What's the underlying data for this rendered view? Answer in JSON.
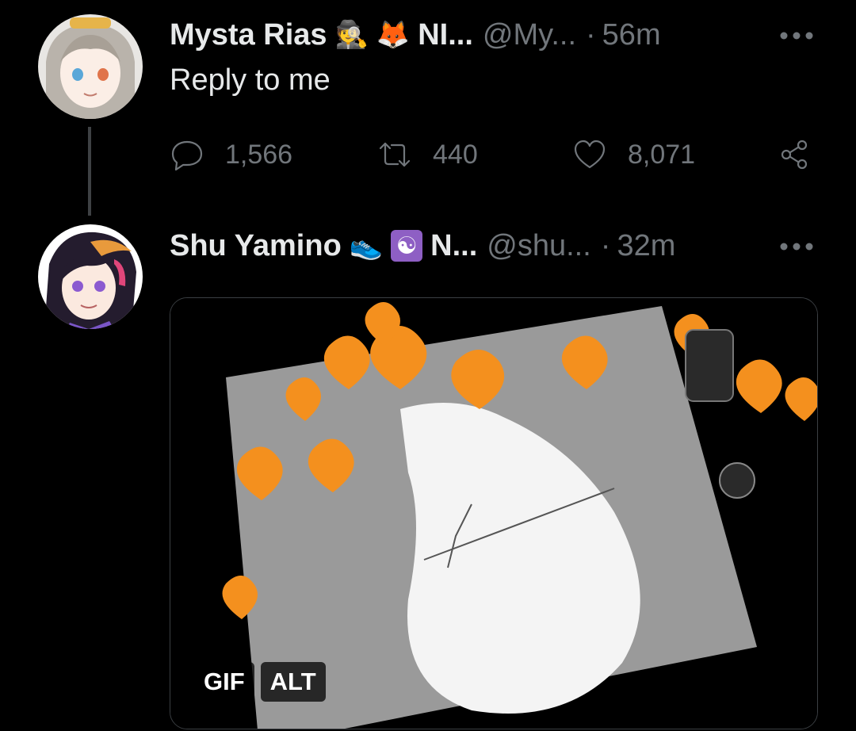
{
  "tweets": [
    {
      "display_name": "Mysta Rias",
      "emojis": [
        {
          "icon": "detective-icon",
          "glyph": "🕵"
        },
        {
          "icon": "fox-icon",
          "glyph": "🦊"
        }
      ],
      "name_trunc": "NI...",
      "handle": "@My...",
      "separator": "·",
      "time": "56m",
      "text": "Reply to me",
      "stats": {
        "replies": "1,566",
        "retweets": "440",
        "likes": "8,071"
      }
    },
    {
      "display_name": "Shu Yamino",
      "emojis": [
        {
          "icon": "running-shoe-icon",
          "glyph": "👟"
        },
        {
          "icon": "yin-yang-icon",
          "glyph": "☯"
        }
      ],
      "name_trunc": "N...",
      "handle": "@shu...",
      "separator": "·",
      "time": "32m",
      "media": {
        "badge_gif": "GIF",
        "badge_alt": "ALT"
      }
    }
  ],
  "colors": {
    "background": "#000000",
    "primary_text": "#e7e9ea",
    "secondary_text": "#71767b",
    "thread_line": "#3e4144",
    "hearts": "#f4901e"
  }
}
